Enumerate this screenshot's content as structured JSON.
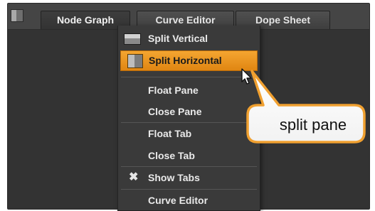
{
  "tabs": [
    {
      "label": "Node Graph",
      "active": true
    },
    {
      "label": "Curve Editor",
      "active": false
    },
    {
      "label": "Dope Sheet",
      "active": false
    }
  ],
  "menu": {
    "items": [
      {
        "label": "Split Vertical",
        "icon": "split-vertical-icon"
      },
      {
        "label": "Split Horizontal",
        "icon": "split-horizontal-icon",
        "highlighted": true
      },
      {
        "label": "Float Pane"
      },
      {
        "label": "Close Pane"
      },
      {
        "label": "Float Tab"
      },
      {
        "label": "Close Tab"
      },
      {
        "label": "Show Tabs",
        "checked": true,
        "icon": "checkmark-x-icon"
      },
      {
        "label": "Curve Editor"
      }
    ]
  },
  "callout": {
    "text": "split pane"
  },
  "colors": {
    "accent": "#f0a030",
    "panel": "#333333",
    "menu_bg": "#3a3a3a",
    "callout_border": "#f0a030"
  }
}
